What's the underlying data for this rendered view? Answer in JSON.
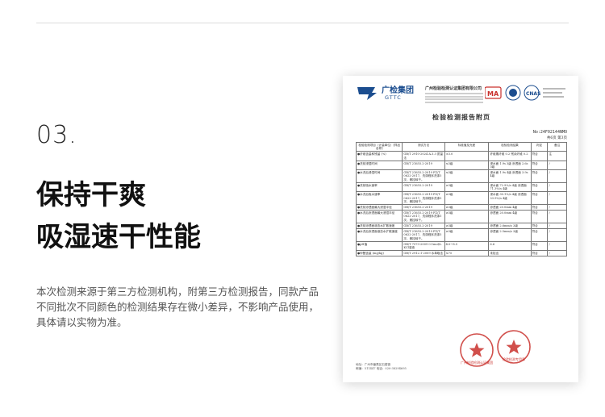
{
  "section": {
    "number": "03.",
    "headline_line1": "保持干爽",
    "headline_line2": "吸湿速干性能",
    "note": "本次检测来源于第三方检测机构，附第三方检测报告，同款产品不同批次不同颜色的检测结果存在微小差异，不影响产品使用，具体请以实物为准。"
  },
  "report": {
    "logo_cn": "广检集团",
    "logo_en": "GTTC",
    "org_name": "广州检验检测认证集团有限公司",
    "title": "检验检测报告附页",
    "report_no": "No:24F02144NMO",
    "page_info": "共6页 第3页",
    "columns": [
      "检验检测项目（计量单位）[样品名称]",
      "测试方法",
      "标准值及允差",
      "检验检测结果",
      "判定",
      "备注"
    ],
    "rows": [
      {
        "item": "●纤维含量和残留 (%)",
        "method": "GB/T 2910-2024 A.3.3 质量法",
        "std": "±3.0",
        "result": "纤维素纤维 0.2 残余纤维 0.2",
        "judge": "符合",
        "remark": "注"
      },
      {
        "item": "●洗前浸湿时间",
        "method": "GB/T 21655.2-2019",
        "std": "≤3级",
        "result": "浸水面 1.9s 3级 渗透面 2.6s 3级",
        "judge": "符合",
        "remark": "/"
      },
      {
        "item": "●水洗后浸湿时间",
        "method": "GB/T 21655.2-2019 FZ/T 0622-2017，洗涤程序洗涤5次，悬挂晾干。",
        "std": "≤3级",
        "result": "浸水面 1.9s 4级 渗透面 3.9s 4级",
        "judge": "符合",
        "remark": "/"
      },
      {
        "item": "●洗前吸水速率",
        "method": "GB/T 21655.2-2019",
        "std": "≥3级",
        "result": "浸水面 72.9%/s 4级 渗透面 71.3%/s 4级",
        "judge": "符合",
        "remark": "/"
      },
      {
        "item": "●水洗后吸水速率",
        "method": "GB/T 21655.2-2019 FZ/T 0622-2017，洗涤程序洗涤5次，悬挂晾干。",
        "std": "≥3级",
        "result": "浸水面 30.1%/s 4级 渗透面 33.9%/s 4级",
        "judge": "符合",
        "remark": "/"
      },
      {
        "item": "●洗前渗透面最大浸湿半径",
        "method": "GB/T 21655.2-2019",
        "std": "≥3级",
        "result": "渗透面 20.0mm 4级",
        "judge": "符合",
        "remark": "/"
      },
      {
        "item": "●水洗后渗透面最大浸湿半径",
        "method": "GB/T 21655.2-2019 FZ/T 0622-2017，洗涤程序洗涤5次，悬挂晾干。",
        "std": "≥3级",
        "result": "渗透面 20.0mm 4级",
        "judge": "符合",
        "remark": "/"
      },
      {
        "item": "●洗前渗透面液态水扩散速度",
        "method": "GB/T 21655.2-2019",
        "std": "≥3级",
        "result": "渗透面 2.6mm/s 3级",
        "judge": "符合",
        "remark": "/"
      },
      {
        "item": "●水洗后渗透面液态水扩散速度",
        "method": "GB/T 21655.2-2019 FZ/T 0622-2017，洗涤程序洗涤5次，悬挂晾干。",
        "std": "≥3级",
        "result": "渗透面 2.5mm/s 3级",
        "judge": "符合",
        "remark": "/"
      },
      {
        "item": "●pH值",
        "method": "GB/T 7573-2009 0.1mol/L KCl溶液",
        "std": "4.0~8.5",
        "result": "6.6",
        "judge": "符合",
        "remark": "/"
      },
      {
        "item": "●甲醛含量 (mg/kg)",
        "method": "GB/T 2912.1-2009 水萃取法",
        "std": "≤75",
        "result": "未检出",
        "judge": "符合",
        "remark": "/"
      }
    ],
    "footer_lines": [
      "地址：广州市番禺区石楼镇",
      "邮编：511447 电话：020-38294695"
    ],
    "stamp1_text": "广州检验检测认证集团",
    "stamp2_text": "检验检测专用章"
  }
}
